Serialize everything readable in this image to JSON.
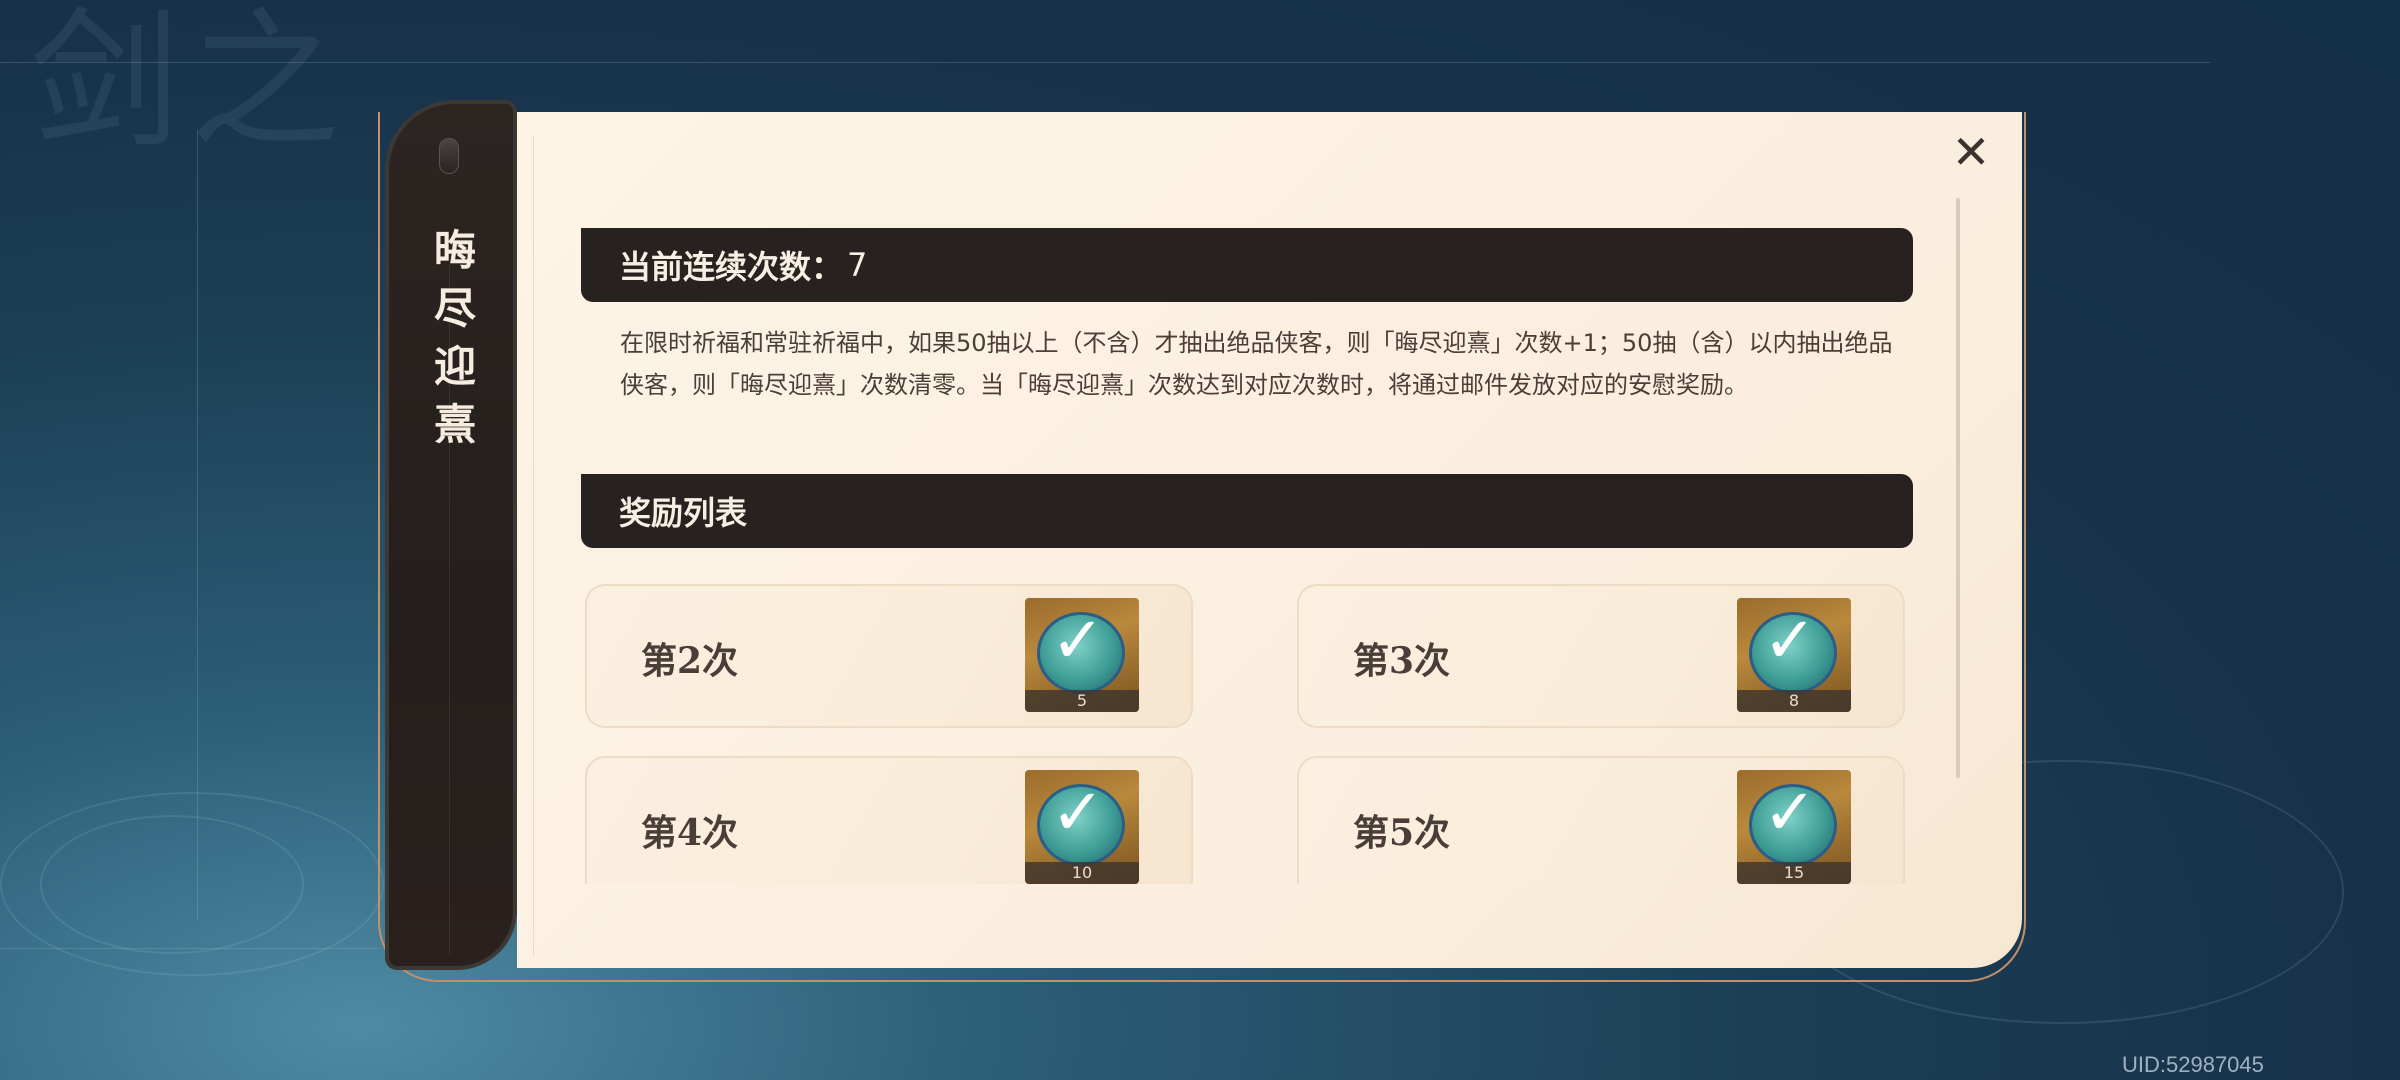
{
  "side_tab": {
    "title_chars": [
      "晦",
      "尽",
      "迎",
      "熹"
    ]
  },
  "section_current": {
    "label": "当前连续次数：",
    "value": "7"
  },
  "description": "在限时祈福和常驻祈福中，如果50抽以上（不含）才抽出绝品侠客，则「晦尽迎熹」次数+1；50抽（含）以内抽出绝品侠客，则「晦尽迎熹」次数清零。当「晦尽迎熹」次数达到对应次数时，将通过邮件发放对应的安慰奖励。",
  "section_rewards": {
    "label": "奖励列表"
  },
  "rewards": [
    {
      "label": "第2次",
      "count": "5",
      "icon": "check-orb-icon"
    },
    {
      "label": "第3次",
      "count": "8",
      "icon": "check-orb-icon"
    },
    {
      "label": "第4次",
      "count": "10",
      "icon": "check-orb-icon"
    },
    {
      "label": "第5次",
      "count": "15",
      "icon": "check-orb-icon"
    }
  ],
  "close_icon": "close-icon",
  "uid": "UID:52987045",
  "colors": {
    "panel_bg": "#fdf4e6",
    "header_bg": "#272120",
    "frame_gold": "#c59068",
    "side_tab_bg": "#2c2522"
  }
}
